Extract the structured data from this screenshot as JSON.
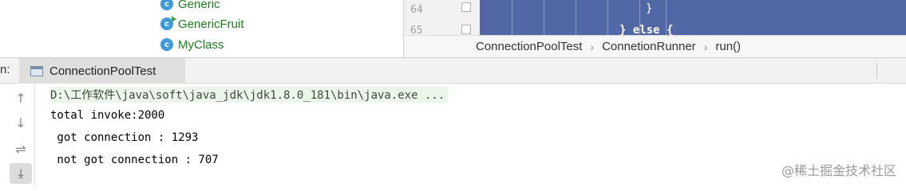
{
  "project_tree": {
    "items": [
      {
        "icon": "class-icon",
        "badge": "",
        "label": "Generic"
      },
      {
        "icon": "class-icon",
        "badge": "run",
        "label": "GenericFruit"
      },
      {
        "icon": "class-icon",
        "badge": "",
        "label": "MyClass"
      }
    ]
  },
  "editor": {
    "line_numbers": [
      "64",
      "65"
    ],
    "code_lines": [
      "}",
      "} else {"
    ],
    "breadcrumb": [
      "ConnectionPoolTest",
      "ConnetionRunner",
      "run()"
    ]
  },
  "run_window": {
    "prefix": "n:",
    "tab_label": "ConnectionPoolTest"
  },
  "toolbar": {
    "up": "↑",
    "down": "↓",
    "wrap": "⇌",
    "scroll_end": "⤓"
  },
  "console": {
    "lines": [
      "D:\\工作软件\\java\\soft\\java_jdk\\jdk1.8.0_181\\bin\\java.exe ...",
      "total invoke:2000",
      " got connection : 1293",
      " not got connection : 707"
    ]
  },
  "watermark": "@稀土掘金技术社区",
  "colors": {
    "editor_selection": "#5167a6",
    "class_icon": "#3f9ad9",
    "tree_label": "#1f7a1f"
  }
}
